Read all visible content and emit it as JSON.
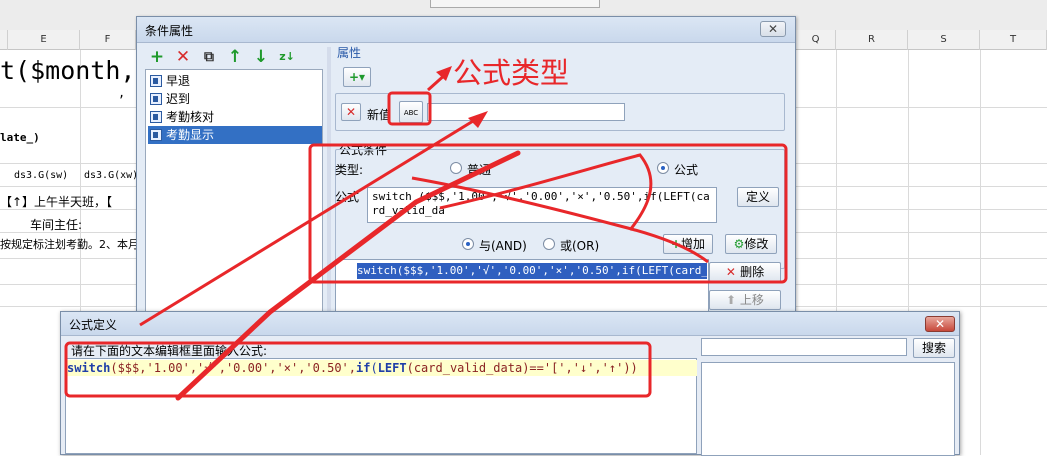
{
  "spreadsheet": {
    "columns": [
      "E",
      "F",
      "Q",
      "R",
      "S",
      "T"
    ],
    "cells": {
      "formula_fragment": "t($month,",
      "comma_cell": ",",
      "date_cell": "late_)",
      "ds_sw": "ds3.G(sw)",
      "ds_xw": "ds3.G(xw)",
      "arrow_note": "【↑】上午半天班，【",
      "director": "车间主任:",
      "note": "按规定标注划考勤。2、本月"
    }
  },
  "condition_dialog": {
    "title": "条件属性",
    "close": "✕",
    "toolbar": {
      "add": "+",
      "delete": "✕",
      "copy": "⧉",
      "up": "↑",
      "down": "↓",
      "sort": "z↓"
    },
    "tree": [
      "早退",
      "迟到",
      "考勤核对",
      "考勤显示"
    ],
    "props_label": "属性",
    "add_drop": "+▾",
    "new_value_label": "新值",
    "abc_icon": "ABC",
    "formula_group_label": "公式条件",
    "type_label": "类型:",
    "type_options": {
      "normal": "普通",
      "formula": "公式"
    },
    "formula_label": "公式",
    "formula_text": "switch ($$$,'1.00','√','0.00','×','0.50',if(LEFT(card_valid_da",
    "define_button": "定义",
    "logic": {
      "and": "与(AND)",
      "or": "或(OR)"
    },
    "add_button": "增加",
    "modify_button": "修改",
    "delete_button": "删除",
    "up_button": "上移",
    "condition_item": "switch($$$,'1.00','√','0.00','×','0.50',if(LEFT(card_vali"
  },
  "formula_dialog": {
    "title": "公式定义",
    "close": "✕",
    "instruction": "请在下面的文本编辑框里面输入公式:",
    "code": {
      "fn": "switch",
      "mid": "($$$,'1.00','√','0.00','×','0.50',",
      "if": "if",
      "lparen": "(",
      "left_fn": "LEFT",
      "arg": "(card_valid_data)=='[','↓','↑'))"
    },
    "search_button": "搜索",
    "search_placeholder": ""
  },
  "annotation": {
    "text": "公式类型",
    "color": "#e8272a"
  }
}
